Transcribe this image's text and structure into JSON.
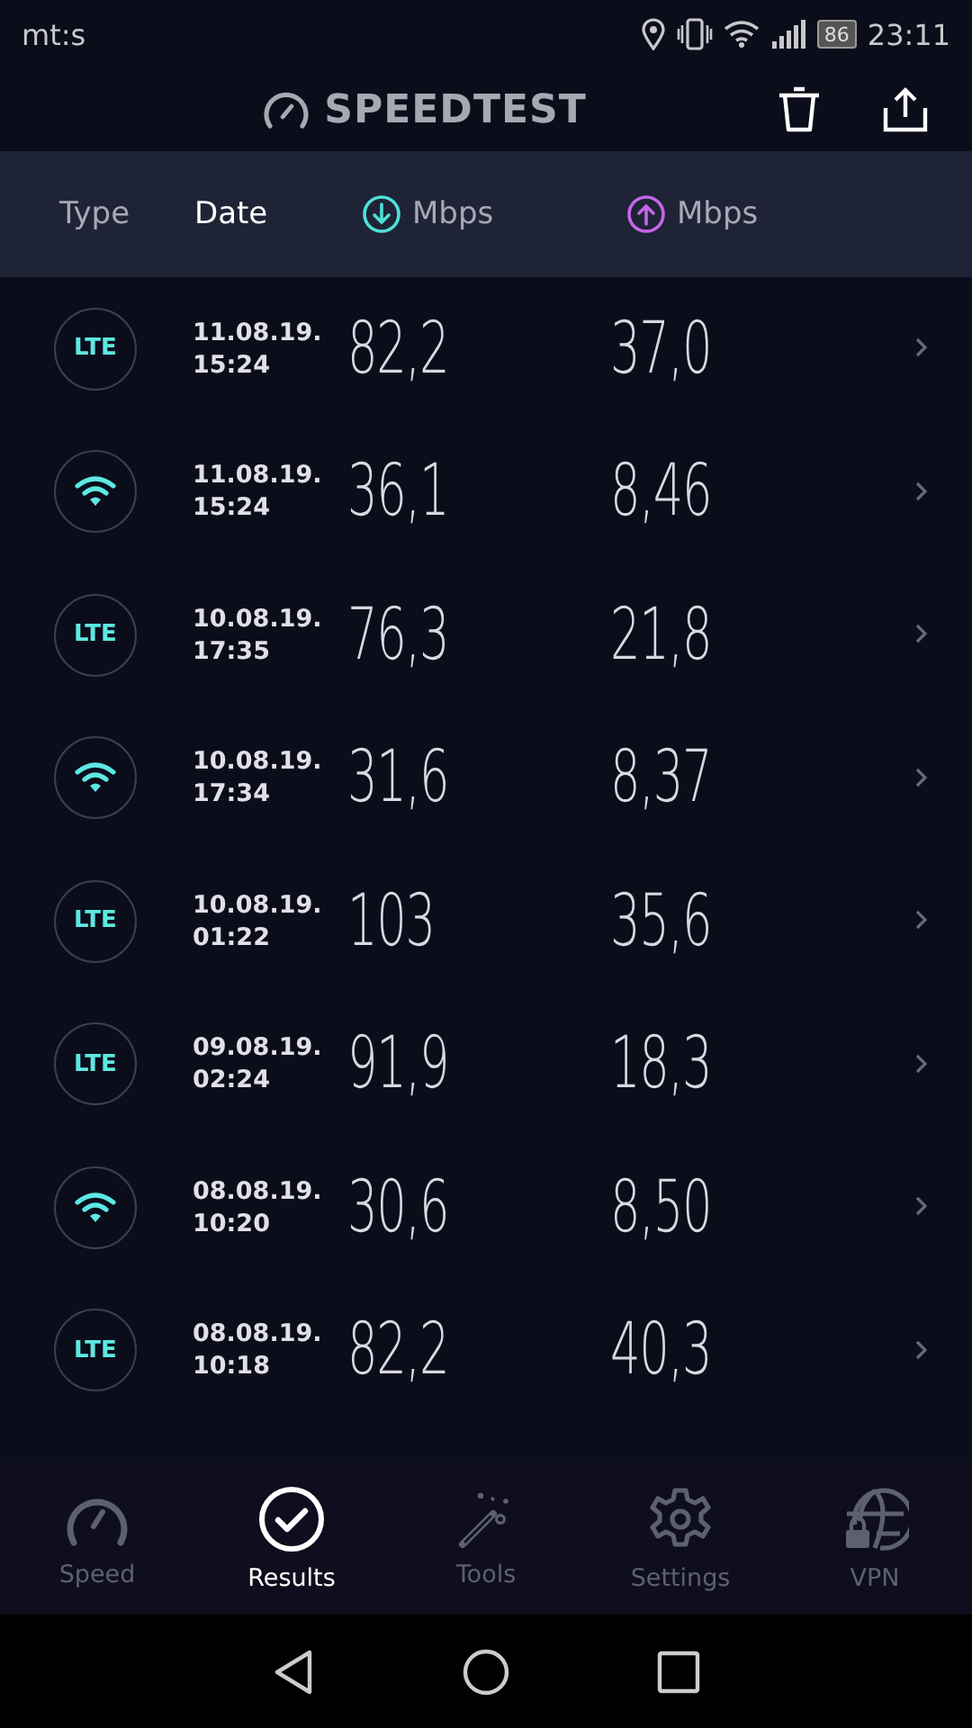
{
  "status_bar": {
    "carrier": "mt:s",
    "battery": "86",
    "time": "23:11"
  },
  "header": {
    "title": "SPEEDTEST"
  },
  "columns": [
    {
      "label": "Type",
      "kind": "text",
      "selected": false
    },
    {
      "label": "Date",
      "kind": "text",
      "selected": true
    },
    {
      "label": "Mbps",
      "kind": "download",
      "selected": false
    },
    {
      "label": "Mbps",
      "kind": "upload",
      "selected": false
    }
  ],
  "results": [
    {
      "kind": "lte",
      "type_label": "LTE",
      "date": "11.08.19.",
      "time": "15:24",
      "download": "82,2",
      "upload": "37,0"
    },
    {
      "kind": "wifi",
      "date": "11.08.19.",
      "time": "15:24",
      "download": "36,1",
      "upload": "8,46"
    },
    {
      "kind": "lte",
      "type_label": "LTE",
      "date": "10.08.19.",
      "time": "17:35",
      "download": "76,3",
      "upload": "21,8"
    },
    {
      "kind": "wifi",
      "date": "10.08.19.",
      "time": "17:34",
      "download": "31,6",
      "upload": "8,37"
    },
    {
      "kind": "lte",
      "type_label": "LTE",
      "date": "10.08.19.",
      "time": "01:22",
      "download": "103",
      "upload": "35,6"
    },
    {
      "kind": "lte",
      "type_label": "LTE",
      "date": "09.08.19.",
      "time": "02:24",
      "download": "91,9",
      "upload": "18,3"
    },
    {
      "kind": "wifi",
      "date": "08.08.19.",
      "time": "10:20",
      "download": "30,6",
      "upload": "8,50"
    },
    {
      "kind": "lte",
      "type_label": "LTE",
      "date": "08.08.19.",
      "time": "10:18",
      "download": "82,2",
      "upload": "40,3"
    }
  ],
  "tabs": [
    {
      "label": "Speed",
      "kind": "speed",
      "selected": false
    },
    {
      "label": "Results",
      "kind": "results",
      "selected": true
    },
    {
      "label": "Tools",
      "kind": "tools",
      "selected": false
    },
    {
      "label": "Settings",
      "kind": "settings",
      "selected": false
    },
    {
      "label": "VPN",
      "kind": "vpn",
      "selected": false
    }
  ]
}
